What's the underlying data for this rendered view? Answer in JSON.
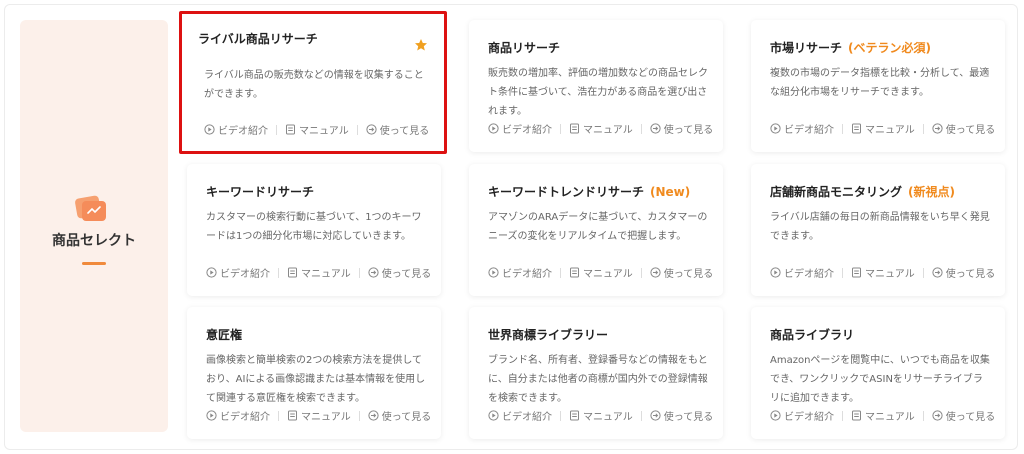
{
  "sidebar": {
    "title": "商品セレクト",
    "icon": "product-select-icon",
    "accent": "#f08a3c"
  },
  "links": {
    "video": "ビデオ紹介",
    "manual": "マニュアル",
    "use": "使って見る"
  },
  "cards": [
    {
      "title": "ライバル商品リサーチ",
      "tag": "",
      "desc": "ライバル商品の販売数などの情報を収集することができます。",
      "selected": true,
      "favorite": true
    },
    {
      "title": "商品リサーチ",
      "tag": "",
      "desc": "販売数の増加率、評価の増加数などの商品セレクト条件に基づいて、浩在力がある商品を選び出されます。"
    },
    {
      "title": "市場リサーチ",
      "tag": "(ベテラン必須)",
      "desc": "複数の市場のデータ指標を比較・分析して、最適な組分化市場をリサーチできます。"
    },
    {
      "title": "キーワードリサーチ",
      "tag": "",
      "desc": "カスタマーの検索行動に基づいて、1つのキーワードは1つの細分化市場に対応していきます。"
    },
    {
      "title": "キーワードトレンドリサーチ",
      "tag": "(New)",
      "desc": "アマゾンのARAデータに基づいて、カスタマーのニーズの変化をリアルタイムで把握します。"
    },
    {
      "title": "店舗新商品モニタリング",
      "tag": "(新視点)",
      "desc": "ライバル店舗の毎日の新商品情報をいち早く発見できます。"
    },
    {
      "title": "意匠権",
      "tag": "",
      "desc": "画像検索と簡単検索の2つの検索方法を提供しており、AIによる画像認識または基本情報を使用して関連する意匠権を検索できます。"
    },
    {
      "title": "世界商標ライブラリー",
      "tag": "",
      "desc": "ブランド名、所有者、登録番号などの情報をもとに、自分または他者の商標が国内外での登録情報を検索できます。"
    },
    {
      "title": "商品ライブラリ",
      "tag": "",
      "desc": "Amazonページを閲覧中に、いつでも商品を収集でき、ワンクリックでASINをリサーチライブラリに追加できます。"
    }
  ]
}
